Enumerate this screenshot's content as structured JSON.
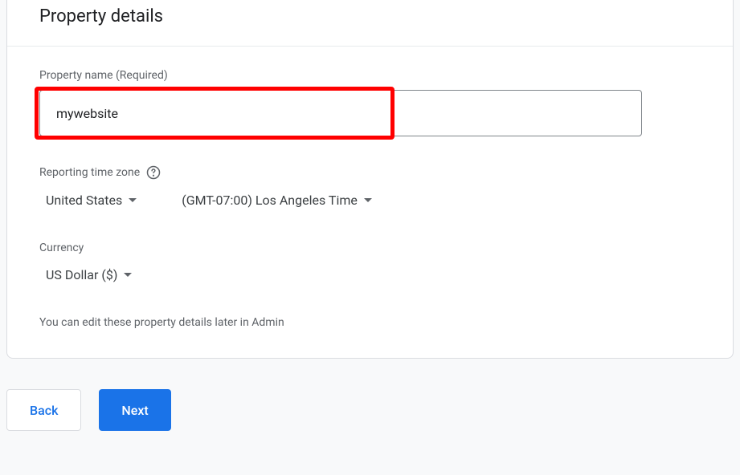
{
  "header": {
    "title": "Property details"
  },
  "property_name": {
    "label": "Property name (Required)",
    "value": "mywebsite"
  },
  "timezone": {
    "label": "Reporting time zone",
    "country": "United States",
    "tz_value": "(GMT-07:00) Los Angeles Time"
  },
  "currency": {
    "label": "Currency",
    "value": "US Dollar ($)"
  },
  "hint": "You can edit these property details later in Admin",
  "buttons": {
    "back": "Back",
    "next": "Next"
  }
}
